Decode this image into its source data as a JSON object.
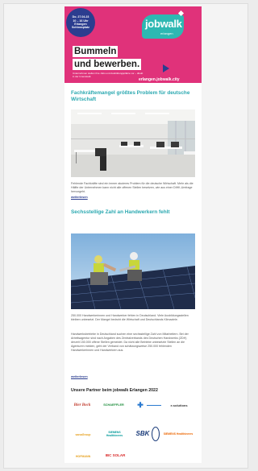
{
  "hero": {
    "burst_lines": [
      "Do. 27.04.23",
      "10 – 16 Uhr",
      "Erlangen",
      "Schlossplatz"
    ],
    "logo_text": "jobwalk",
    "logo_sub": "erlangen",
    "headline_line1": "Bummeln",
    "headline_line2": "und bewerben.",
    "small_text": "Unternehmen stellen ihre Jobs und Ausbildungsplätze vor – direkt in der Innenstadt.",
    "url": "erlangen.jobwalk.city",
    "color": "#e0327a"
  },
  "articles": [
    {
      "title": "Fachkräftemangel größtes Problem für deutsche Wirtschaft",
      "body": "Fehlende Fachkräfte sind ein immer akuteres Problem für die deutsche Wirtschaft. Mehr als die Hälfte der Unternehmen kann nicht alle offenen Stellen besetzen, wie aus einer DIHK-Umfrage hervorgeht.",
      "more": "weiterlesen"
    },
    {
      "title": "Sechsstellige Zahl an Handwerkern fehlt",
      "body1": "250.000 Handwerkerinnen und Handwerker fehlen in Deutschland. Viele Ausbildungsstellen bleiben unbesetzt. Der Mangel bedroht die Wirtschaft und Deutschlands Klimaziele.",
      "body2": "Handwerksbetriebe in Deutschland suchen eine sechsstellige Zahl von Mitarbeitern. Bei der Arbeitsagentur sind nach Angaben des Zentralverbands des Deutschen Handwerks (ZDH) derzeit 150.000 offene Stellen gemeldet. Da nicht alle Betriebe unbesetzte Stellen an die Agenturen melden, geht der Verband von schätzungsweise 250.000 fehlenden Handwerkerinnen und Handwerkern aus.",
      "more": "weiterlesen"
    }
  ],
  "partners": {
    "title": "Unsere Partner beim jobwalk Erlangen 2022",
    "logos": [
      "Bier Bock",
      "SCHAEFFLER",
      "✚",
      "e.solutions",
      "sanaGroup",
      "SIEMENS Healthineers",
      "SBK",
      "SIEMENS Healthineers",
      "HOFMANN",
      "IBC SOLAR"
    ]
  }
}
